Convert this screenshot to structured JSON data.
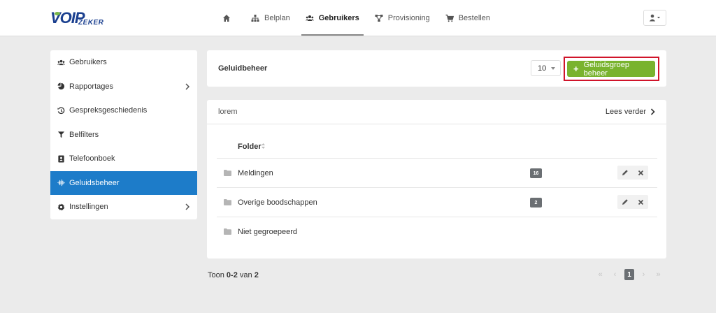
{
  "brand": {
    "logo_main": "VOIP",
    "logo_sub": "ZEKER"
  },
  "nav": {
    "items": [
      {
        "label": "",
        "icon": "home-icon"
      },
      {
        "label": "Belplan",
        "icon": "sitemap-icon"
      },
      {
        "label": "Gebruikers",
        "icon": "users-icon",
        "active": true
      },
      {
        "label": "Provisioning",
        "icon": "nodes-icon"
      },
      {
        "label": "Bestellen",
        "icon": "cart-icon"
      }
    ],
    "user_menu_icon": "user-icon"
  },
  "sidebar": {
    "items": [
      {
        "label": "Gebruikers",
        "icon": "users-icon"
      },
      {
        "label": "Rapportages",
        "icon": "pie-chart-icon",
        "has_submenu": true
      },
      {
        "label": "Gespreksgeschiedenis",
        "icon": "history-icon"
      },
      {
        "label": "Belfilters",
        "icon": "filter-icon"
      },
      {
        "label": "Telefoonboek",
        "icon": "contact-book-icon"
      },
      {
        "label": "Geluidsbeheer",
        "icon": "sound-wave-icon",
        "active": true
      },
      {
        "label": "Instellingen",
        "icon": "gear-icon",
        "has_submenu": true
      }
    ],
    "active_color": "#1d7cc9"
  },
  "header": {
    "title": "Geluidbeheer",
    "per_page_value": "10",
    "add_button_label": "Geluidsgroep beheer",
    "add_button_color": "#79b32e",
    "highlight_color": "#d0142a"
  },
  "content": {
    "intro_text": "lorem",
    "read_more_label": "Lees verder",
    "column_header": "Folder",
    "rows": [
      {
        "name": "Meldingen",
        "count": "16",
        "has_actions": true
      },
      {
        "name": "Overige boodschappen",
        "count": "2",
        "has_actions": true
      },
      {
        "name": "Niet gegroepeerd",
        "count": "",
        "has_actions": false
      }
    ]
  },
  "footer": {
    "prefix": "Toon",
    "range": "0-2",
    "middle": "van",
    "total": "2"
  },
  "pagination": {
    "first": "«",
    "prev": "‹",
    "current": "1",
    "next": "›",
    "last": "»"
  }
}
